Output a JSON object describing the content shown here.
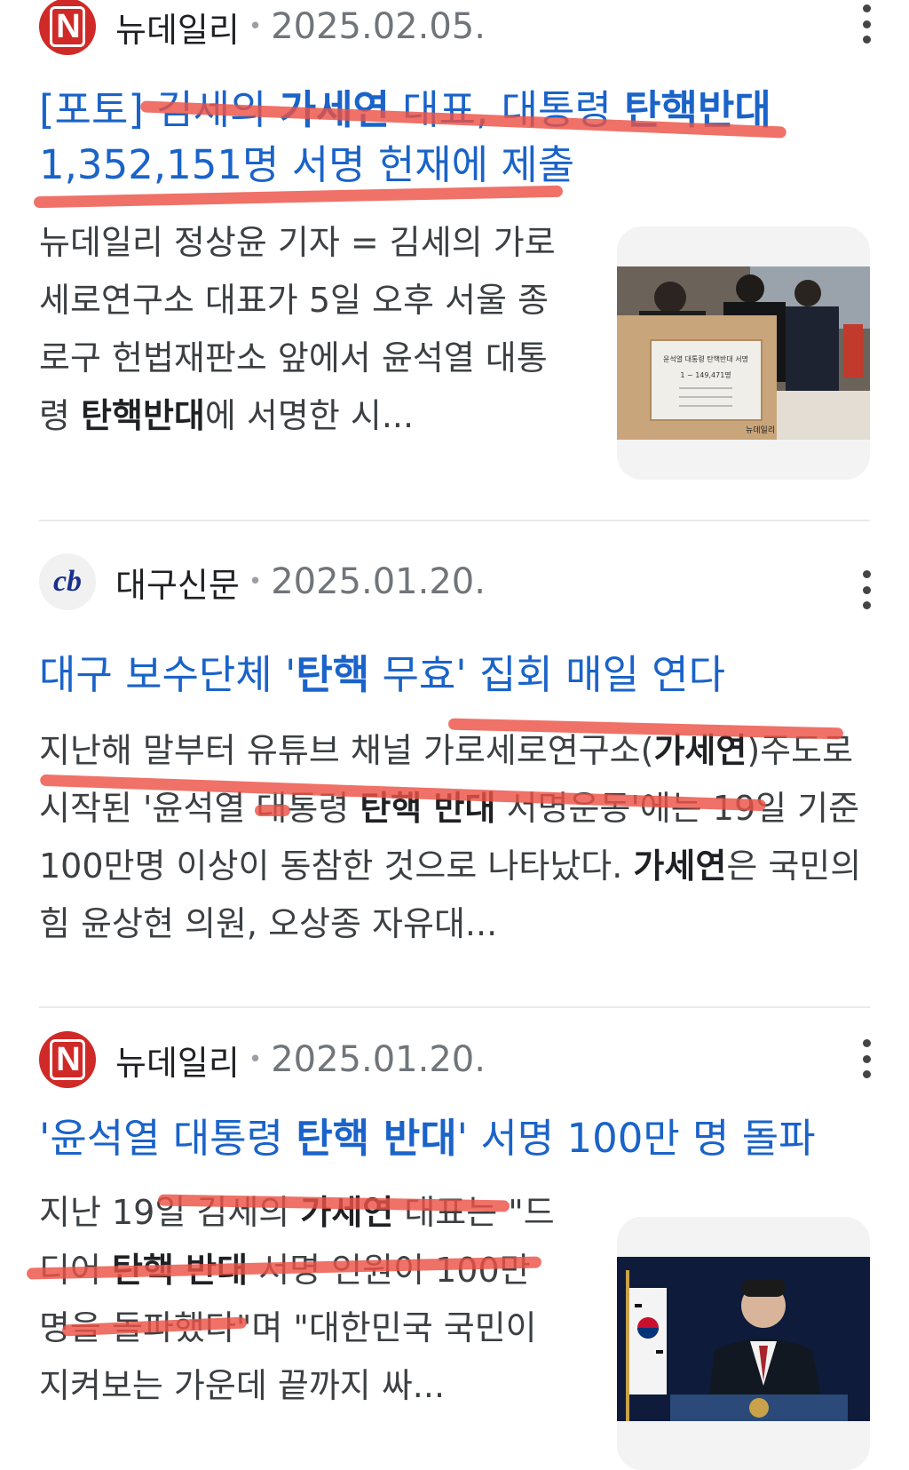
{
  "results": [
    {
      "source": "뉴데일리",
      "logo_icon": "newdaily-logo-icon",
      "logo_letter": "N",
      "date": "2025.02.05.",
      "title_parts": {
        "a": "[포토] 김세의 ",
        "b": "가세연",
        "c": " 대표, 대통령 ",
        "d": "탄핵반대",
        "e": " 1,352,151명 서명 헌재에 제출"
      },
      "snippet_parts": {
        "a": "뉴데일리 정상윤 기자 = 김세의 가로세로연구소 대표가 5일 오후 서울 종로구 헌법재판소 앞에서 윤석열 대통령 ",
        "b": "탄핵반대",
        "c": "에 서명한 시..."
      },
      "thumb_box_lines": [
        "윤석열 대통령 탄핵반대 서명",
        "1 ~ 149,471명"
      ],
      "thumb_watermark": "뉴데일리"
    },
    {
      "source": "대구신문",
      "logo_icon": "daegu-shinmun-logo-icon",
      "logo_letter": "cb",
      "date": "2025.01.20.",
      "title_parts": {
        "a": "대구 보수단체 '",
        "b": "탄핵",
        "c": " 무효' 집회 매일 연다"
      },
      "snippet_parts": {
        "a": "지난해 말부터 유튜브 채널 가로세로연구소(",
        "b": "가세연",
        "c": ")주도로 시작된 '윤석열 대통령 ",
        "d": "탄핵 반대",
        "e": " 서명운동'에는 19일 기준 100만명 이상이 동참한 것으로 나타났다. ",
        "f": "가세연",
        "g": "은 국민의힘 윤상현 의원, 오상종 자유대..."
      }
    },
    {
      "source": "뉴데일리",
      "logo_icon": "newdaily-logo-icon",
      "logo_letter": "N",
      "date": "2025.01.20.",
      "title_parts": {
        "a": "'윤석열 대통령 ",
        "b": "탄핵 반대",
        "c": "' 서명 100만 명 돌파"
      },
      "snippet_parts": {
        "a": "지난 19일 김세의 ",
        "b": "가세연",
        "c": " 대표는 \"드디어 ",
        "d": "탄핵 반대",
        "e": " 서명 인원이 100만 명을 돌파했다\"며 \"대한민국 국민이 지켜보는 가운데 끝까지 싸..."
      }
    }
  ],
  "colors": {
    "title_link": "#1a63c9",
    "highlight_marker": "#ec5246",
    "newdaily_red": "#cf2a27",
    "daegu_blue": "#1b2f8f"
  },
  "icons": {
    "more": "more-vert-icon"
  }
}
